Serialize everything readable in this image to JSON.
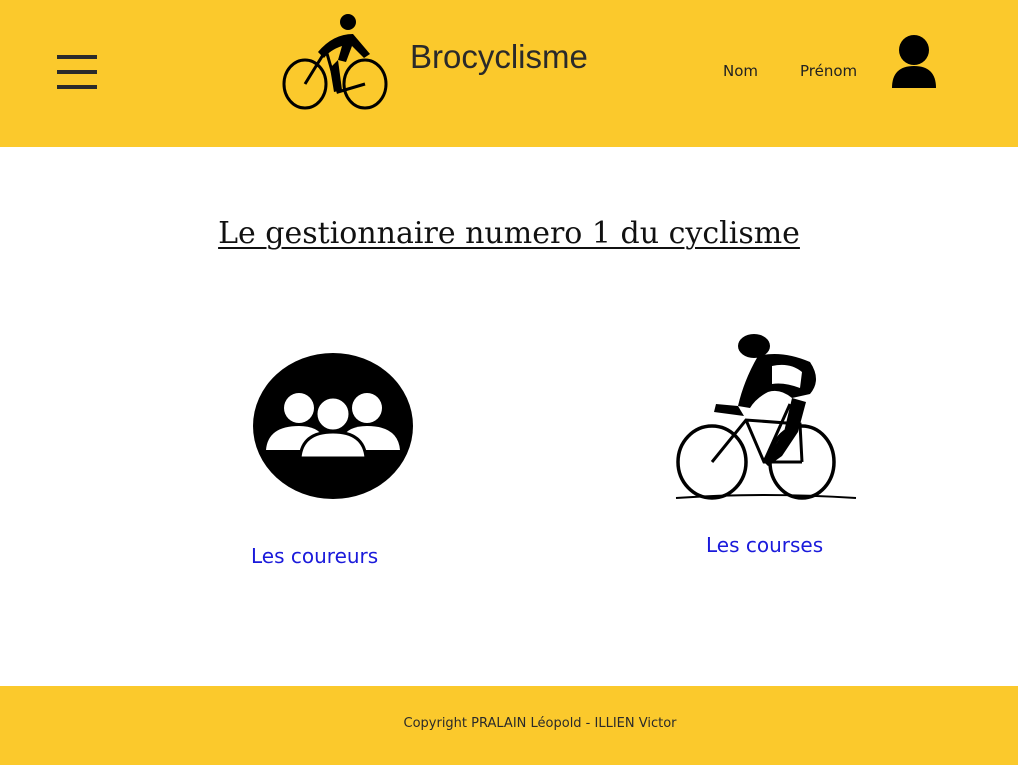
{
  "header": {
    "menu_icon": "hamburger-menu-icon",
    "logo_icon": "cyclist-logo-icon",
    "brand": "Brocyclisme",
    "user": {
      "nom_label": "Nom",
      "prenom_label": "Prénom",
      "avatar_icon": "user-avatar-icon"
    },
    "background_color": "#fbc92c"
  },
  "main": {
    "title": "Le gestionnaire numero 1 du cyclisme",
    "tiles": [
      {
        "icon": "group-of-people-icon",
        "link_label": "Les coureurs"
      },
      {
        "icon": "racing-cyclist-icon",
        "link_label": "Les courses"
      }
    ]
  },
  "footer": {
    "copyright": "Copyright PRALAIN Léopold - ILLIEN Victor",
    "background_color": "#fbc92c"
  },
  "colors": {
    "accent": "#fbc92c",
    "link": "#1a1adb"
  }
}
